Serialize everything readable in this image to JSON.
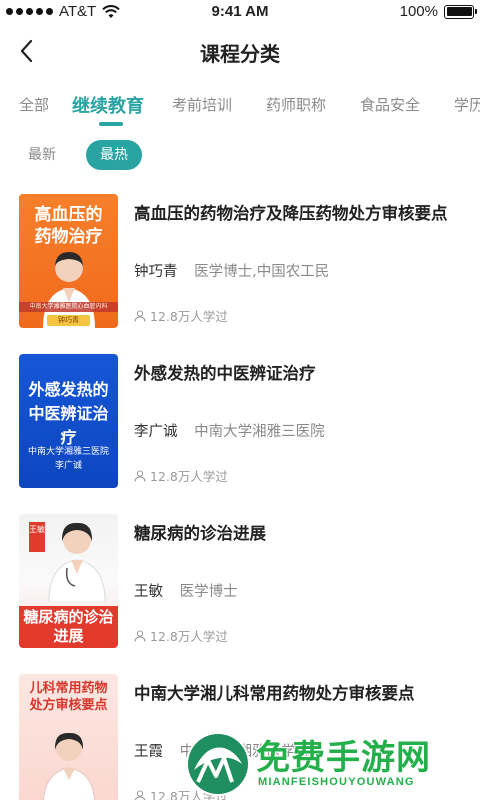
{
  "status_bar": {
    "carrier": "AT&T",
    "time": "9:41 AM",
    "battery": "100%",
    "battery_level": 1.0
  },
  "nav": {
    "title": "课程分类",
    "back_icon": "chevron-left-icon"
  },
  "category_tabs": [
    {
      "label": "全部",
      "active": false
    },
    {
      "label": "继续教育",
      "active": true
    },
    {
      "label": "考前培训",
      "active": false
    },
    {
      "label": "药师职称",
      "active": false
    },
    {
      "label": "食品安全",
      "active": false
    },
    {
      "label": "学历",
      "active": false
    }
  ],
  "sort_options": [
    {
      "label": "最新",
      "active": false
    },
    {
      "label": "最热",
      "active": true
    }
  ],
  "courses": [
    {
      "title": "高血压的药物治疗及降压药物处方审核要点",
      "teacher": "钟巧青",
      "affiliation": "医学博士,中国农工民",
      "learners": "12.8万人学过",
      "thumb_text": "高血压的药物治疗",
      "thumb_sub": "中南大学湘雅医院心血管内科",
      "thumb_name": "钟巧青"
    },
    {
      "title": "外感发热的中医辨证治疗",
      "teacher": "李广诚",
      "affiliation": "中南大学湘雅三医院",
      "learners": "12.8万人学过",
      "thumb_text": "外感发热的中医辨证治疗",
      "thumb_sub": "中南大学湘雅三医院",
      "thumb_name": "李广诚"
    },
    {
      "title": "糖尿病的诊治进展",
      "teacher": "王敏",
      "affiliation": "医学博士",
      "learners": "12.8万人学过",
      "thumb_text": "糖尿病的诊治进展",
      "thumb_name": "王敏"
    },
    {
      "title": "中南大学湘儿科常用药物处方审核要点",
      "teacher": "王霞",
      "affiliation": "中南大学湘雅医学院",
      "learners": "12.8万人学过",
      "thumb_text": "儿科常用药物处方审核要点"
    }
  ],
  "watermark": {
    "title": "免费手游网",
    "subtitle": "MIANFEISHOUYOUWANG"
  },
  "colors": {
    "accent": "#2aa3a3",
    "watermark": "#23b04b"
  }
}
